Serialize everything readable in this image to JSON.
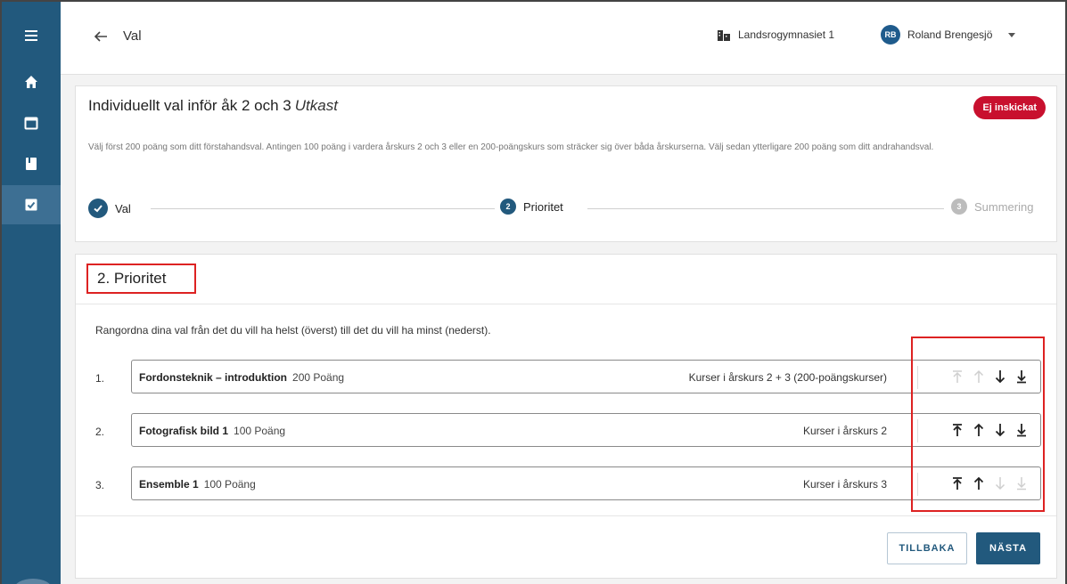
{
  "header": {
    "page_name": "Val",
    "school": "Landsrogymnasiet 1",
    "user_initials": "RB",
    "user_name": "Roland Brengesjö"
  },
  "card": {
    "title": "Individuellt val inför åk 2 och 3",
    "status_word": "Utkast",
    "badge": "Ej inskickat",
    "intro": "Välj först 200 poäng som ditt förstahandsval. Antingen 100 poäng i vardera årskurs 2 och 3 eller en 200-poängskurs som sträcker sig över båda årskurserna. Välj sedan ytterligare 200 poäng som ditt andrahandsval."
  },
  "stepper": {
    "steps": [
      {
        "label": "Val",
        "number": ""
      },
      {
        "label": "Prioritet",
        "number": "2"
      },
      {
        "label": "Summering",
        "number": "3"
      }
    ]
  },
  "priority": {
    "heading": "2. Prioritet",
    "instruction": "Rangordna dina val från det du vill ha helst (överst) till det du vill ha minst (nederst).",
    "rows": [
      {
        "num": "1.",
        "name": "Fordonsteknik – introduktion",
        "points": "200 Poäng",
        "category": "Kurser i årskurs 2 + 3 (200-poängskurser)"
      },
      {
        "num": "2.",
        "name": "Fotografisk bild 1",
        "points": "100 Poäng",
        "category": "Kurser i årskurs 2"
      },
      {
        "num": "3.",
        "name": "Ensemble 1",
        "points": "100 Poäng",
        "category": "Kurser i årskurs 3"
      }
    ]
  },
  "buttons": {
    "back": "TILLBAKA",
    "next": "NÄSTA"
  },
  "colors": {
    "sidebar": "#22597d",
    "accent": "#22597d",
    "badge": "#c8102e",
    "highlight": "#dd2222"
  }
}
